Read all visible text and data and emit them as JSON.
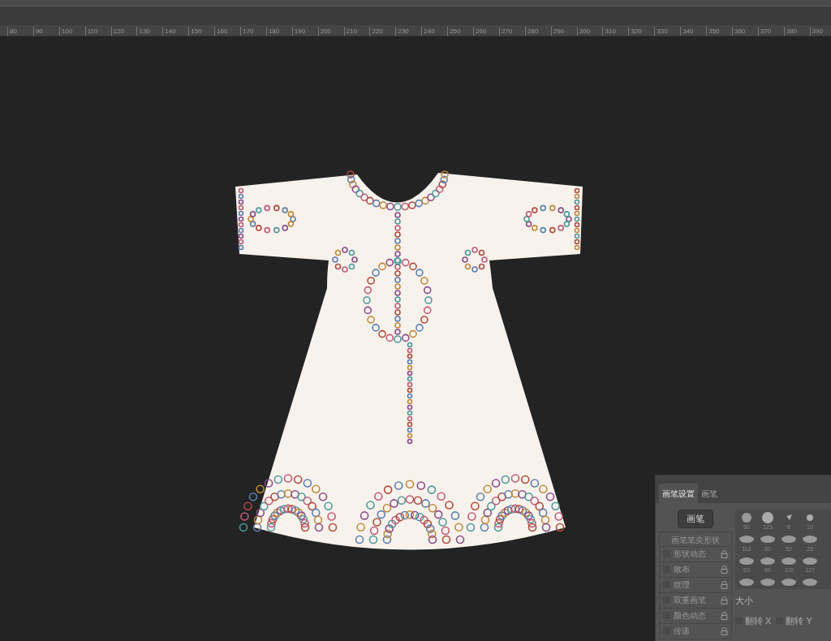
{
  "ruler": {
    "labels": [
      "80",
      "90",
      "100",
      "110",
      "120",
      "130",
      "140",
      "150",
      "160",
      "170",
      "180",
      "190",
      "200",
      "210",
      "220",
      "230",
      "240",
      "250",
      "260",
      "270",
      "280",
      "290",
      "300",
      "310",
      "320",
      "330",
      "340",
      "350",
      "360",
      "370",
      "380",
      "390"
    ]
  },
  "brush_panel": {
    "tabs": [
      {
        "label": "画笔设置",
        "selected": true
      },
      {
        "label": "画笔",
        "selected": false
      }
    ],
    "brushes_button": "画笔",
    "tip_shape_header": "画笔笔尖形状",
    "options": [
      {
        "label": "形状动态",
        "checked": false
      },
      {
        "label": "散布",
        "checked": false
      },
      {
        "label": "纹理",
        "checked": false
      },
      {
        "label": "双重画笔",
        "checked": false
      },
      {
        "label": "颜色动态",
        "checked": false
      },
      {
        "label": "传递",
        "checked": false
      }
    ],
    "presets": [
      {
        "size": "30"
      },
      {
        "size": "123"
      },
      {
        "size": "8"
      },
      {
        "size": "10"
      },
      {
        "size": "112"
      },
      {
        "size": "60"
      },
      {
        "size": "50"
      },
      {
        "size": "25"
      },
      {
        "size": "50"
      },
      {
        "size": "60"
      },
      {
        "size": "100"
      },
      {
        "size": "127"
      }
    ],
    "size_label": "大小",
    "flips": [
      {
        "label": "翻转 X",
        "checked": false
      },
      {
        "label": "翻转 Y",
        "checked": false
      }
    ]
  }
}
